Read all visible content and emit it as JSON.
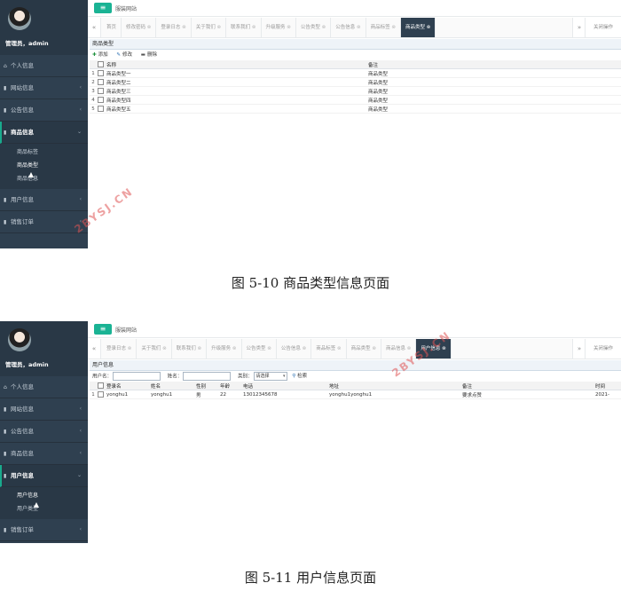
{
  "screenshot1": {
    "sidebar": {
      "username": "管理员，admin",
      "nav": [
        {
          "label": "个人信息",
          "icon": "home-icon"
        },
        {
          "label": "网站信息",
          "icon": "list-icon"
        },
        {
          "label": "公告信息",
          "icon": "list-icon"
        },
        {
          "label": "商品信息",
          "icon": "list-icon",
          "open": true,
          "sub": [
            "商品标签",
            "商品类型",
            "商品信息"
          ]
        },
        {
          "label": "用户信息",
          "icon": "list-icon"
        },
        {
          "label": "销售订单",
          "icon": "list-icon"
        }
      ]
    },
    "topbar": {
      "menu_icon": "hamburger-icon",
      "site_title": "服装网站"
    },
    "tabs": [
      "首页",
      "修改密码",
      "登录日志",
      "关于我们",
      "联系我们",
      "升级服务",
      "公告类型",
      "公告信息",
      "商品标签",
      "商品类型"
    ],
    "active_tab": "商品类型",
    "tab_close_all": "关闭操作",
    "panel_title": "商品类型",
    "toolbar": {
      "add": "添加",
      "edit": "修改",
      "delete": "删除"
    },
    "table": {
      "columns": [
        "名称",
        "备注"
      ],
      "rows": [
        [
          "1",
          "商品类型一",
          "商品类型"
        ],
        [
          "2",
          "商品类型二",
          "商品类型"
        ],
        [
          "3",
          "商品类型三",
          "商品类型"
        ],
        [
          "4",
          "商品类型四",
          "商品类型"
        ],
        [
          "5",
          "商品类型五",
          "商品类型"
        ]
      ]
    }
  },
  "caption1": "图 5-10 商品类型信息页面",
  "screenshot2": {
    "sidebar": {
      "username": "管理员，admin",
      "nav": [
        {
          "label": "个人信息",
          "icon": "home-icon"
        },
        {
          "label": "网站信息",
          "icon": "list-icon"
        },
        {
          "label": "公告信息",
          "icon": "list-icon"
        },
        {
          "label": "商品信息",
          "icon": "list-icon"
        },
        {
          "label": "用户信息",
          "icon": "list-icon",
          "open": true,
          "sub": [
            "用户信息",
            "用户类型"
          ]
        },
        {
          "label": "销售订单",
          "icon": "list-icon"
        }
      ]
    },
    "topbar": {
      "menu_icon": "hamburger-icon",
      "site_title": "服装网站"
    },
    "tabs": [
      "登录日志",
      "关于我们",
      "联系我们",
      "升级服务",
      "公告类型",
      "公告信息",
      "商品标签",
      "商品类型",
      "商品信息",
      "用户信息"
    ],
    "active_tab": "用户信息",
    "tab_close_all": "关闭操作",
    "panel_title": "用户信息",
    "search": {
      "username_label": "用户名：",
      "name_label": "姓名：",
      "category_label": "类别：",
      "category_value": "请选择",
      "search_label": "检索"
    },
    "table": {
      "columns": [
        "登录名",
        "姓名",
        "性别",
        "年龄",
        "电话",
        "地址",
        "备注",
        "时间"
      ],
      "rows": [
        [
          "1",
          "yonghu1",
          "yonghu1",
          "男",
          "22",
          "13012345678",
          "yonghu1yonghu1",
          "要求点赞",
          "2021-"
        ]
      ]
    }
  },
  "caption2": "图 5-11 用户信息页面",
  "watermark": "2BYSJ.CN",
  "colors": {
    "sidebar": "#2f4050",
    "accent": "#1ab394",
    "active_tab": "#2f4050",
    "watermark": "#e05555"
  }
}
